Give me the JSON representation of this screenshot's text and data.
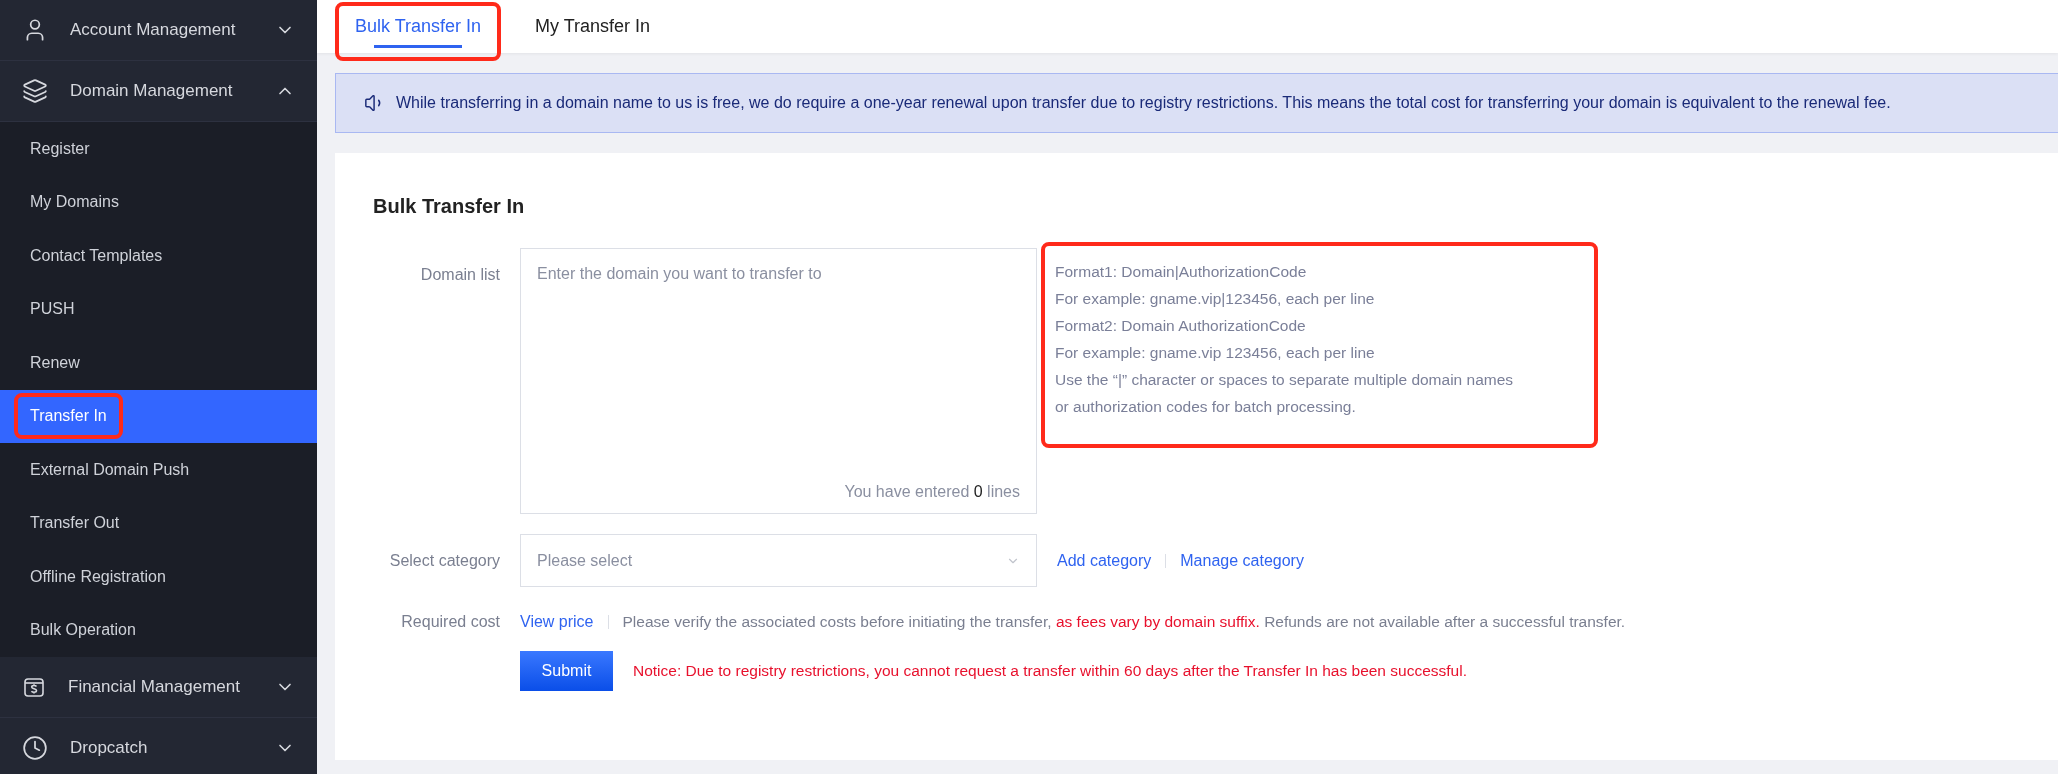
{
  "sidebar": {
    "groups": [
      {
        "label": "Account Management",
        "expanded": false
      },
      {
        "label": "Domain Management",
        "expanded": true,
        "items": [
          {
            "label": "Register",
            "selected": false,
            "highlighted": false
          },
          {
            "label": "My Domains",
            "selected": false,
            "highlighted": false
          },
          {
            "label": "Contact Templates",
            "selected": false,
            "highlighted": false
          },
          {
            "label": "PUSH",
            "selected": false,
            "highlighted": false
          },
          {
            "label": "Renew",
            "selected": false,
            "highlighted": false
          },
          {
            "label": "Transfer In",
            "selected": true,
            "highlighted": true
          },
          {
            "label": "External Domain Push",
            "selected": false,
            "highlighted": false
          },
          {
            "label": "Transfer Out",
            "selected": false,
            "highlighted": false
          },
          {
            "label": "Offline Registration",
            "selected": false,
            "highlighted": false
          },
          {
            "label": "Bulk Operation",
            "selected": false,
            "highlighted": false
          }
        ]
      },
      {
        "label": "Financial Management",
        "expanded": false
      },
      {
        "label": "Dropcatch",
        "expanded": false
      }
    ]
  },
  "tabs": [
    {
      "label": "Bulk Transfer In",
      "selected": true,
      "highlighted": true
    },
    {
      "label": "My Transfer In",
      "selected": false,
      "highlighted": false
    }
  ],
  "notice": "While transferring in a domain name to us is free, we do require a one-year renewal upon transfer due to registry restrictions. This means the total cost for transferring your domain is equivalent to the renewal fee.",
  "form": {
    "title": "Bulk Transfer In",
    "domain_list": {
      "label": "Domain list",
      "placeholder": "Enter the domain you want to transfer to",
      "count_prefix": "You have entered",
      "count": "0",
      "count_suffix": "lines"
    },
    "hint": {
      "highlighted": true,
      "lines": [
        "Format1: Domain|AuthorizationCode",
        "For example: gname.vip|123456, each per line",
        "Format2: Domain AuthorizationCode",
        "For example: gname.vip 123456, each per line",
        "Use the “|” character or spaces to separate multiple domain names",
        "or authorization codes for batch processing."
      ]
    },
    "category": {
      "label": "Select category",
      "placeholder": "Please select",
      "links": [
        "Add category",
        "Manage category"
      ]
    },
    "cost": {
      "label": "Required cost",
      "link": "View price",
      "text_before": "Please verify the associated costs before initiating the transfer,",
      "warning": "as fees vary by domain suffix.",
      "text_after": "Refunds are not available after a successful transfer."
    },
    "submit": "Submit",
    "submit_notice": "Notice: Due to registry restrictions, you cannot request a transfer within 60 days after the Transfer In has been successful."
  }
}
